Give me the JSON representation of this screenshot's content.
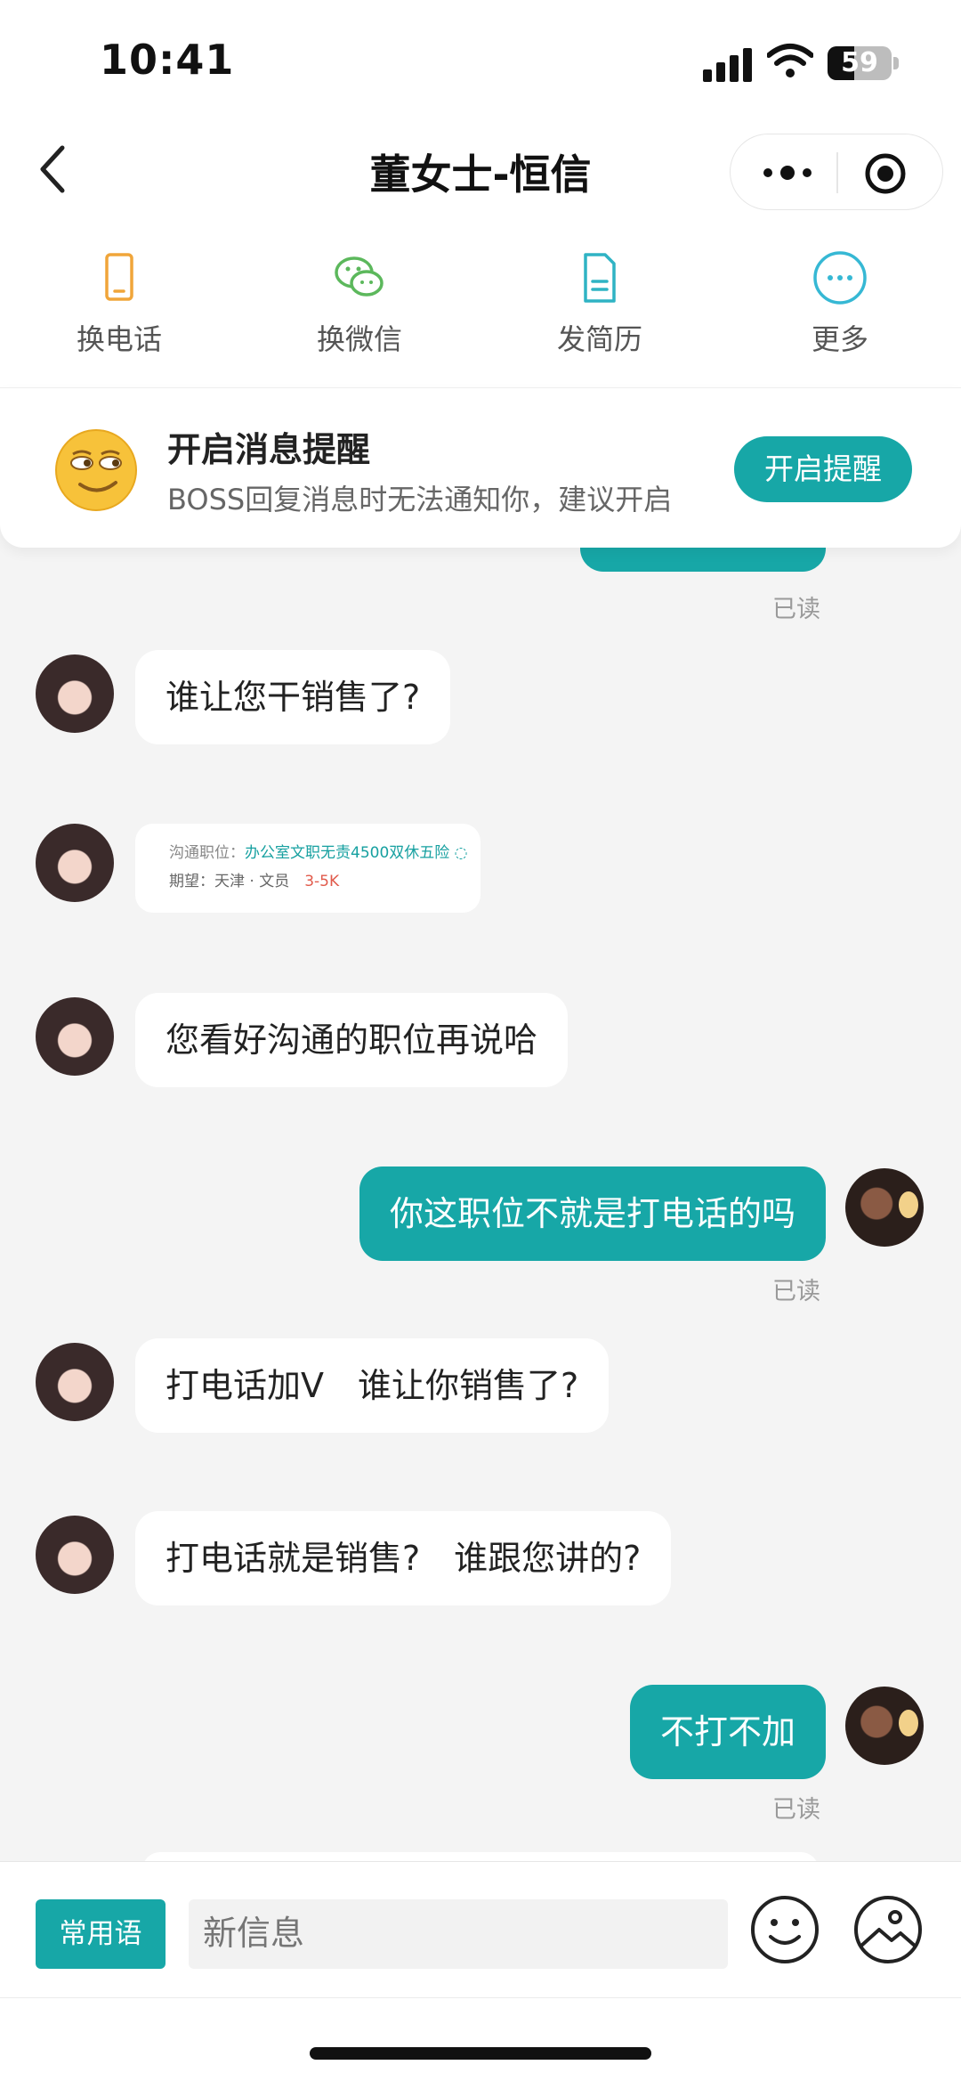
{
  "status_bar": {
    "time": "10:41",
    "battery": "59"
  },
  "nav": {
    "title": "董女士-恒信"
  },
  "actions": [
    {
      "label": "换电话",
      "icon": "phone-icon"
    },
    {
      "label": "换微信",
      "icon": "wechat-icon"
    },
    {
      "label": "发简历",
      "icon": "resume-icon"
    },
    {
      "label": "更多",
      "icon": "more-icon"
    }
  ],
  "notice": {
    "title": "开启消息提醒",
    "desc": "BOSS回复消息时无法通知你，建议开启",
    "button": "开启提醒"
  },
  "read_label": "已读",
  "messages": [
    {
      "side": "left",
      "text": "谁让您干销售了?"
    },
    {
      "side": "left",
      "type": "job-card",
      "row1_label": "沟通职位：",
      "row1_value": "办公室文职无责4500双休五险 ◌",
      "row2_label": "期望：天津 · 文员",
      "row2_salary": "3-5K"
    },
    {
      "side": "left",
      "text": "您看好沟通的职位再说哈"
    },
    {
      "side": "right",
      "text": "你这职位不就是打电话的吗"
    },
    {
      "side": "left",
      "text": "打电话加V　谁让你销售了?"
    },
    {
      "side": "left",
      "text": "打电话就是销售?　谁跟您讲的?"
    },
    {
      "side": "right",
      "text": "不打不加"
    }
  ],
  "input_bar": {
    "phrase_button": "常用语",
    "placeholder": "新信息"
  },
  "colors": {
    "accent": "#17a7a7",
    "background": "#f4f4f4"
  }
}
